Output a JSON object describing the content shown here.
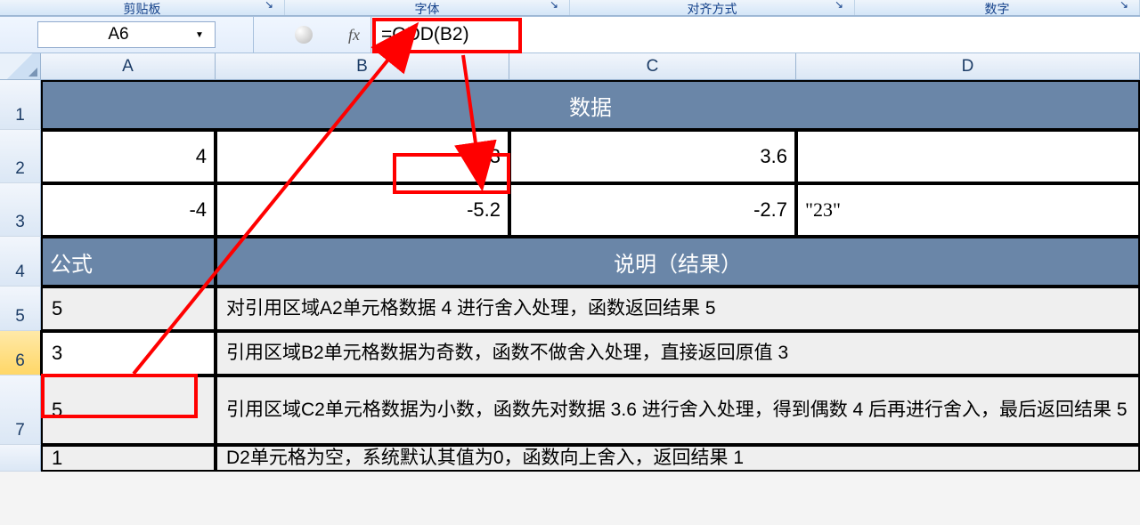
{
  "ribbon": {
    "groups": [
      "剪贴板",
      "字体",
      "对齐方式",
      "数字"
    ]
  },
  "formula_bar": {
    "cell_ref": "A6",
    "fx_label": "fx",
    "formula": "=ODD(B2)"
  },
  "columns": [
    "A",
    "B",
    "C",
    "D"
  ],
  "row_numbers": [
    "1",
    "2",
    "3",
    "4",
    "5",
    "6",
    "7",
    ""
  ],
  "row1": {
    "merged_title": "数据"
  },
  "row2": {
    "A": "4",
    "B": "3",
    "C": "3.6",
    "D": ""
  },
  "row3": {
    "A": "-4",
    "B": "-5.2",
    "C": "-2.7",
    "D": "\"23\""
  },
  "row4": {
    "A": "公式",
    "BCD": "说明（结果）"
  },
  "row5": {
    "A": "5",
    "desc": "对引用区域A2单元格数据 4 进行舍入处理，函数返回结果 5"
  },
  "row6": {
    "A": "3",
    "desc": "引用区域B2单元格数据为奇数，函数不做舍入处理，直接返回原值 3"
  },
  "row7": {
    "A": "5",
    "desc": "引用区域C2单元格数据为小数，函数先对数据 3.6 进行舍入处理，得到偶数 4 后再进行舍入，最后返回结果 5"
  },
  "row8": {
    "A": "1",
    "desc": "D2单元格为空，系统默认其值为0，函数向上舍入，返回结果 1"
  }
}
